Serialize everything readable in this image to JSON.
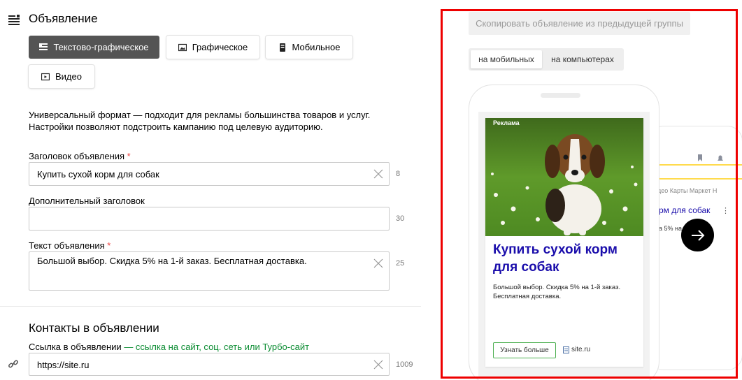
{
  "section": {
    "title": "Объявление",
    "format_buttons": [
      {
        "label": "Текстово-графическое",
        "active": true,
        "icon": "text-image-icon"
      },
      {
        "label": "Графическое",
        "active": false,
        "icon": "image-icon"
      },
      {
        "label": "Мобильное",
        "active": false,
        "icon": "mobile-icon"
      },
      {
        "label": "Видео",
        "active": false,
        "icon": "video-icon"
      }
    ],
    "description": "Универсальный формат — подходит для рекламы большинства товаров и услуг. Настройки позволяют подстроить кампанию под целевую аудиторию."
  },
  "fields": {
    "headline": {
      "label": "Заголовок объявления",
      "required_mark": "*",
      "value": "Купить сухой корм для собак",
      "counter": "8"
    },
    "sub_headline": {
      "label": "Дополнительный заголовок",
      "value": "",
      "counter": "30"
    },
    "text": {
      "label": "Текст объявления",
      "required_mark": "*",
      "value": "Большой выбор. Скидка 5% на 1-й заказ. Бесплатная доставка.",
      "counter": "25"
    }
  },
  "contacts": {
    "title": "Контакты в объявлении",
    "link_label": "Ссылка в объявлении",
    "link_hint": "— ссылка на сайт, соц. сеть или Турбо-сайт",
    "link_value": "https://site.ru",
    "link_counter": "1009"
  },
  "preview": {
    "copy_button": "Скопировать объявление из предыдущей группы",
    "device_tabs": [
      {
        "label": "на мобильных",
        "active": true
      },
      {
        "label": "на компьютерах",
        "active": false
      }
    ],
    "ad": {
      "badge": "Реклама",
      "headline": "Купить сухой корм для собак",
      "body": "Большой выбор. Скидка 5% на 1-й заказ. Бесплатная доставка.",
      "cta": "Узнать больше",
      "site": "site.ru"
    },
    "back_phone": {
      "nav": "део   Карты   Маркет   Н",
      "headline": "рм для собак",
      "dots": "⋮",
      "sub": "а 5% на"
    }
  },
  "colors": {
    "accent_dark": "#545454",
    "required": "#ee4444",
    "hint_green": "#0b8c32",
    "ad_link": "#1a0dab",
    "highlight_frame": "#ee0000"
  }
}
